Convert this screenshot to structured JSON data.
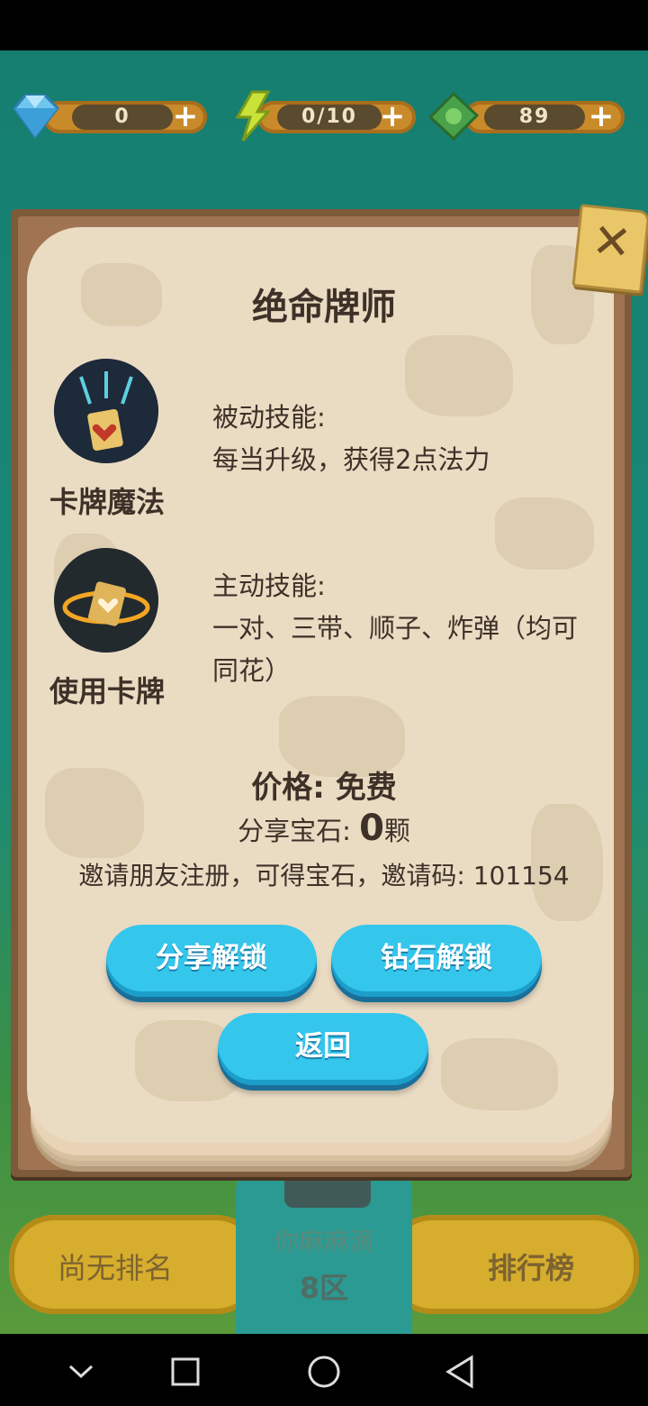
{
  "hud": {
    "gems": "0",
    "energy": "0/10",
    "cash": "89"
  },
  "dialog": {
    "title": "绝命牌师",
    "skill1": {
      "name": "卡牌魔法",
      "type_label": "被动技能:",
      "description": "每当升级，获得2点法力"
    },
    "skill2": {
      "name": "使用卡牌",
      "type_label": "主动技能:",
      "description_line1": "一对、三带、顺子、炸弹（均可",
      "description_line2": "同花）"
    },
    "price": "价格: 免费",
    "share_gems_label": "分享宝石: ",
    "share_gems_value": "0",
    "share_gems_unit": "颗",
    "invite_text": "邀请朋友注册，可得宝石，邀请码: 101154",
    "share_unlock": "分享解锁",
    "diamond_unlock": "钻石解锁",
    "back": "返回"
  },
  "bottom": {
    "no_rank": "尚无排名",
    "player_name": "你麻麻滴",
    "zone": "8区",
    "leaderboard": "排行榜"
  },
  "colors": {
    "accent_button": "#35c6ec",
    "paper": "#eadbc3",
    "frame": "#7d5a3a"
  }
}
